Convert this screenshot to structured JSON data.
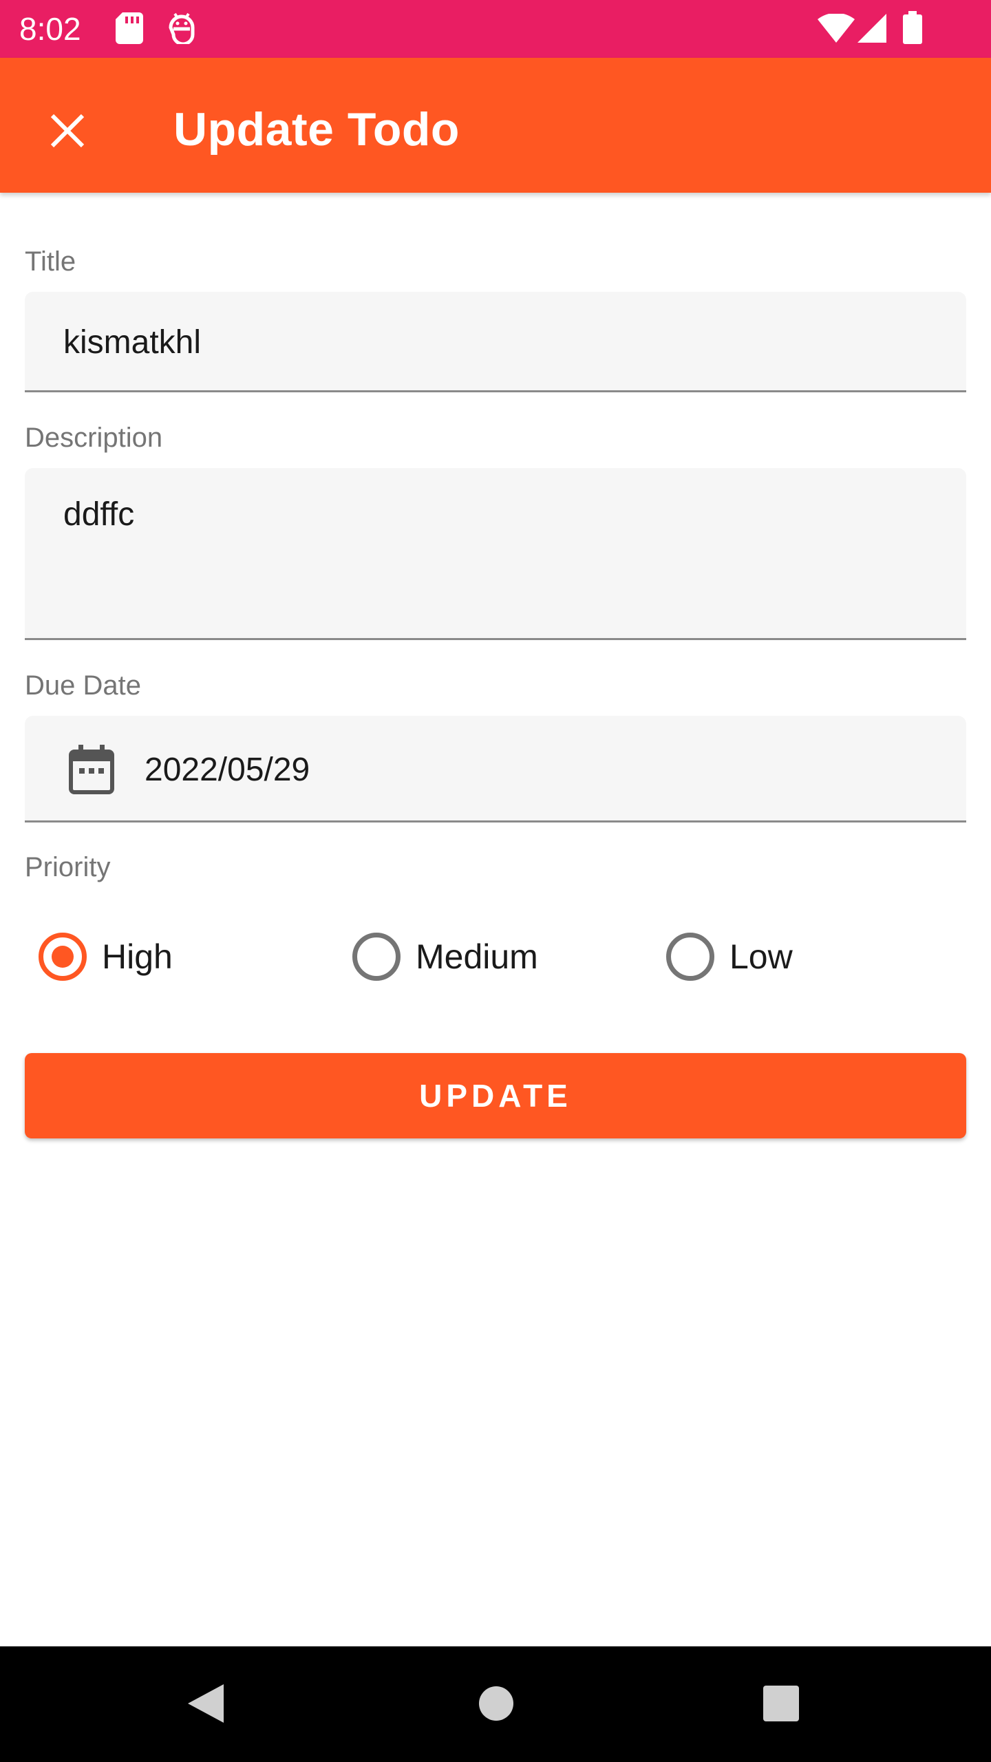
{
  "status_bar": {
    "time": "8:02",
    "icons": [
      "sd-card-icon",
      "android-debug-icon",
      "wifi-icon",
      "signal-icon",
      "battery-icon"
    ],
    "background": "#E91E63"
  },
  "app_bar": {
    "title": "Update Todo",
    "close_icon": "close-icon",
    "background": "#FF5722"
  },
  "form": {
    "title": {
      "label": "Title",
      "value": "kismatkhl"
    },
    "description": {
      "label": "Description",
      "value": "ddffc"
    },
    "due_date": {
      "label": "Due Date",
      "value": "2022/05/29",
      "icon": "calendar-icon"
    },
    "priority": {
      "label": "Priority",
      "options": [
        {
          "label": "High",
          "checked": true
        },
        {
          "label": "Medium",
          "checked": false
        },
        {
          "label": "Low",
          "checked": false
        }
      ]
    },
    "submit_label": "UPDATE"
  },
  "colors": {
    "accent": "#FF5722",
    "field_background": "#F6F6F6",
    "label_gray": "#757575"
  },
  "nav_bar": {
    "buttons": [
      "back-icon",
      "home-icon",
      "recents-icon"
    ]
  }
}
